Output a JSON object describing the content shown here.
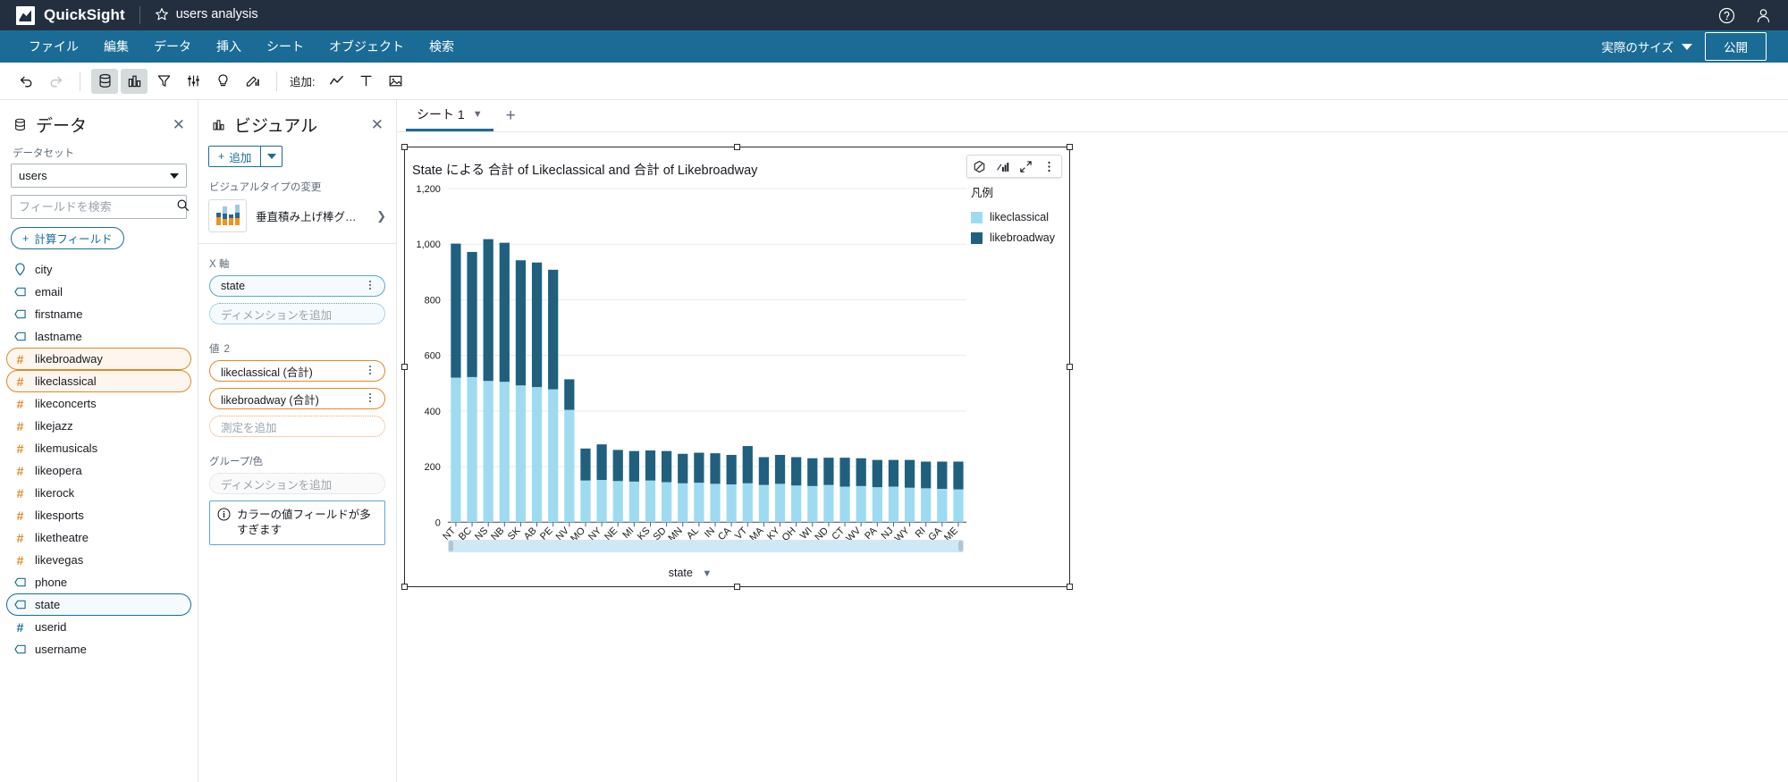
{
  "topbar": {
    "product_name": "QuickSight",
    "logo_icon": "quicksight-logo-icon",
    "favorite_icon": "star-icon",
    "doc_title": "users analysis",
    "help_icon": "help-circle-icon",
    "account_icon": "user-account-icon"
  },
  "menubar": {
    "items": [
      {
        "label": "ファイル",
        "name": "menu-file"
      },
      {
        "label": "編集",
        "name": "menu-edit"
      },
      {
        "label": "データ",
        "name": "menu-data"
      },
      {
        "label": "挿入",
        "name": "menu-insert"
      },
      {
        "label": "シート",
        "name": "menu-sheet"
      },
      {
        "label": "オブジェクト",
        "name": "menu-object"
      },
      {
        "label": "検索",
        "name": "menu-search"
      }
    ],
    "size_selector": "実際のサイズ",
    "publish_label": "公開"
  },
  "toolbar": {
    "undo_icon": "undo-icon",
    "redo_icon": "redo-icon",
    "dataset_icon": "database-icon",
    "visual_icon": "bar-chart-icon",
    "filter_icon": "filter-icon",
    "parameter_icon": "sliders-icon",
    "insight_icon": "lightbulb-icon",
    "theme_icon": "theme-paint-icon",
    "add_label": "追加:",
    "add_visual_icon": "line-chart-icon",
    "add_text_icon": "text-icon",
    "add_image_icon": "image-icon"
  },
  "data_panel": {
    "icon": "database-icon",
    "title": "データ",
    "close_icon": "close-icon",
    "dataset_label": "データセット",
    "dataset_value": "users",
    "search_placeholder": "フィールドを検索",
    "search_value": "",
    "search_icon": "search-icon",
    "calc_field_label": "計算フィールド",
    "fields": [
      {
        "name": "city",
        "icon": "geo-pin-icon",
        "type": "geo",
        "state": "none"
      },
      {
        "name": "email",
        "icon": "string-tag-icon",
        "type": "string",
        "state": "none"
      },
      {
        "name": "firstname",
        "icon": "string-tag-icon",
        "type": "string",
        "state": "none"
      },
      {
        "name": "lastname",
        "icon": "string-tag-icon",
        "type": "string",
        "state": "none"
      },
      {
        "name": "likebroadway",
        "icon": "number-hash-icon",
        "type": "number",
        "state": "selected-orange"
      },
      {
        "name": "likeclassical",
        "icon": "number-hash-icon",
        "type": "number",
        "state": "selected-orange"
      },
      {
        "name": "likeconcerts",
        "icon": "number-hash-icon",
        "type": "number",
        "state": "none"
      },
      {
        "name": "likejazz",
        "icon": "number-hash-icon",
        "type": "number",
        "state": "none"
      },
      {
        "name": "likemusicals",
        "icon": "number-hash-icon",
        "type": "number",
        "state": "none"
      },
      {
        "name": "likeopera",
        "icon": "number-hash-icon",
        "type": "number",
        "state": "none"
      },
      {
        "name": "likerock",
        "icon": "number-hash-icon",
        "type": "number",
        "state": "none"
      },
      {
        "name": "likesports",
        "icon": "number-hash-icon",
        "type": "number",
        "state": "none"
      },
      {
        "name": "liketheatre",
        "icon": "number-hash-icon",
        "type": "number",
        "state": "none"
      },
      {
        "name": "likevegas",
        "icon": "number-hash-icon",
        "type": "number",
        "state": "none"
      },
      {
        "name": "phone",
        "icon": "string-tag-icon",
        "type": "string",
        "state": "none"
      },
      {
        "name": "state",
        "icon": "string-tag-icon",
        "type": "string",
        "state": "selected-blue"
      },
      {
        "name": "userid",
        "icon": "number-hash-icon-blue",
        "type": "number",
        "state": "none"
      },
      {
        "name": "username",
        "icon": "string-tag-icon",
        "type": "string",
        "state": "none"
      }
    ]
  },
  "visual_panel": {
    "icon": "bar-chart-icon",
    "title": "ビジュアル",
    "close_icon": "close-icon",
    "add_label": "追加",
    "add_caret_icon": "caret-down-icon",
    "change_type_label": "ビジュアルタイプの変更",
    "visual_type_name": "垂直積み上げ棒グ…",
    "visual_type_thumb_icon": "stacked-bar-chart-icon",
    "visual_type_chevron_icon": "chevron-right-icon",
    "wells": [
      {
        "label": "X 軸",
        "count": "",
        "name": "well-x-axis",
        "pills": [
          {
            "label": "state",
            "style": "blue",
            "menu_icon": "kebab-menu-icon"
          }
        ],
        "empty": {
          "label": "ディメンションを追加",
          "style": "blue"
        }
      },
      {
        "label": "値",
        "count": "2",
        "name": "well-value",
        "pills": [
          {
            "label": "likeclassical (合計)",
            "style": "orange",
            "menu_icon": "kebab-menu-icon"
          },
          {
            "label": "likebroadway (合計)",
            "style": "orange",
            "menu_icon": "kebab-menu-icon"
          }
        ],
        "empty": {
          "label": "測定を追加",
          "style": "orange"
        }
      },
      {
        "label": "グループ/色",
        "count": "",
        "name": "well-group-color",
        "pills": [],
        "empty": {
          "label": "ディメンションを追加",
          "style": "grey"
        }
      }
    ],
    "warning": {
      "icon": "info-circle-icon",
      "text": "カラーの値フィールドが多すぎます"
    }
  },
  "sheet": {
    "tab_label": "シート 1",
    "tab_chevron_icon": "chevron-down-icon",
    "add_tab_icon": "plus-icon"
  },
  "visual": {
    "title": "State による 合計 of Likeclassical and 合計 of Likebroadway",
    "menu_icons": [
      "prohibited-circle-icon",
      "insights-chart-icon",
      "expand-arrows-icon",
      "kebab-menu-icon"
    ],
    "legend_title": "凡例",
    "x_axis_footer_label": "state",
    "x_axis_footer_chevron_icon": "chevron-down-icon",
    "scrollbar_name": "horizontal-scrollbar"
  },
  "chart_data": {
    "type": "bar",
    "subtype": "stacked-vertical",
    "title": "State による 合計 of Likeclassical and 合計 of Likebroadway",
    "xlabel": "state",
    "ylabel": "",
    "ylim": [
      0,
      1200
    ],
    "yticks": [
      0,
      200,
      400,
      600,
      800,
      1000,
      1200
    ],
    "ytick_labels": [
      "0",
      "200",
      "400",
      "600",
      "800",
      "1,000",
      "1,200"
    ],
    "grid": true,
    "legend_position": "right",
    "colors": {
      "likeclassical": "#9fdbf0",
      "likebroadway": "#20607e"
    },
    "categories": [
      "NT",
      "BC",
      "NS",
      "NB",
      "SK",
      "AB",
      "PE",
      "NV",
      "MO",
      "NY",
      "NE",
      "MI",
      "KS",
      "SD",
      "MN",
      "AL",
      "IN",
      "CA",
      "VT",
      "MA",
      "KY",
      "OH",
      "WI",
      "ND",
      "CT",
      "WV",
      "PA",
      "NJ",
      "WY",
      "RI",
      "GA",
      "ME"
    ],
    "series": [
      {
        "name": "likeclassical",
        "color": "#9fdbf0",
        "values": [
          520,
          522,
          508,
          505,
          492,
          486,
          478,
          404,
          150,
          152,
          148,
          146,
          150,
          144,
          140,
          142,
          138,
          136,
          140,
          134,
          138,
          132,
          130,
          134,
          128,
          130,
          126,
          128,
          124,
          122,
          120,
          118
        ]
      },
      {
        "name": "likebroadway",
        "color": "#20607e",
        "values": [
          482,
          450,
          510,
          500,
          450,
          448,
          430,
          110,
          115,
          128,
          112,
          110,
          108,
          112,
          106,
          108,
          110,
          106,
          134,
          100,
          104,
          102,
          100,
          98,
          104,
          100,
          98,
          96,
          100,
          96,
          98,
          100
        ]
      }
    ],
    "totals": [
      1002,
      972,
      1018,
      1005,
      942,
      934,
      908,
      514,
      265,
      280,
      260,
      256,
      258,
      256,
      246,
      250,
      248,
      242,
      274,
      234,
      242,
      234,
      230,
      232,
      232,
      230,
      224,
      224,
      224,
      218,
      218,
      218
    ]
  }
}
